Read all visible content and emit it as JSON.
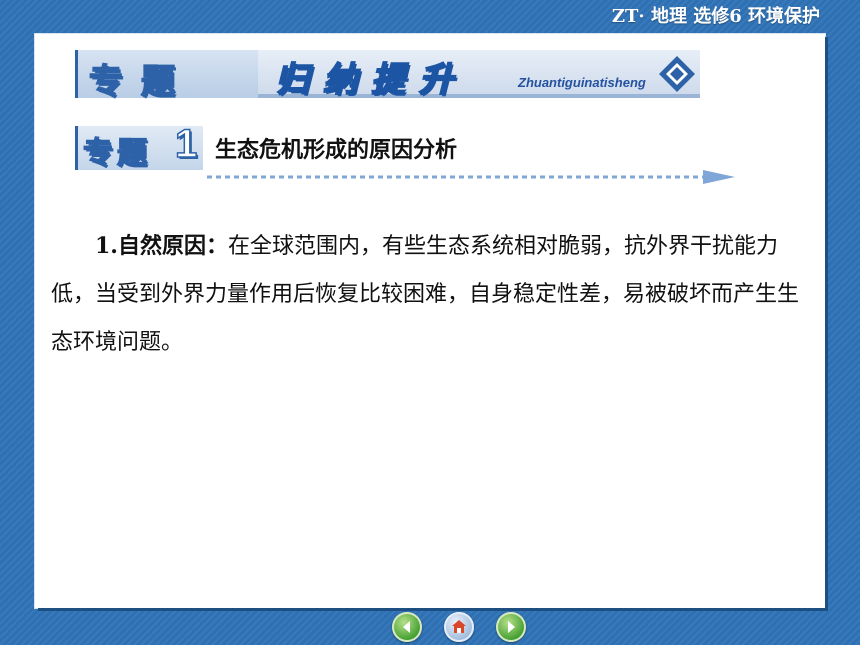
{
  "header": {
    "text": "ZT· 地理  选修6   环境保护"
  },
  "banner": {
    "label": "专题",
    "title": "归纳提升",
    "pinyin": "Zhuantiguinatisheng"
  },
  "topic": {
    "label": "专题",
    "number": "1",
    "title": "生态危机形成的原因分析"
  },
  "body": {
    "lead": "1.自然原因：",
    "text": "在全球范围内，有些生态系统相对脆弱，抗外界干扰能力低，当受到外界力量作用后恢复比较困难，自身稳定性差，易被破坏而产生生态环境问题。"
  },
  "nav": {
    "buttons": [
      "back-button",
      "home-button",
      "forward-button"
    ]
  },
  "colors": {
    "background": "#2f74b8",
    "accent": "#2d62a8",
    "arrow": "#7fa6d6"
  }
}
